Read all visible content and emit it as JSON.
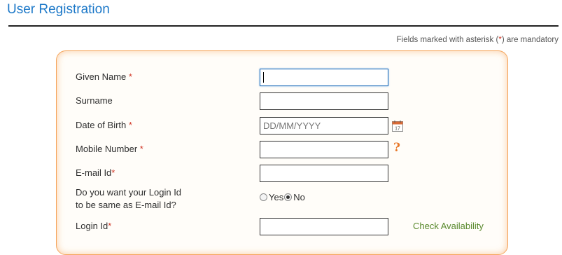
{
  "page": {
    "title": "User Registration",
    "mandatory_note": {
      "before": "Fields marked with asterisk (",
      "asterisk": "*",
      "after": ") are mandatory"
    }
  },
  "form": {
    "given_name": {
      "label": "Given Name",
      "required_mark": "*",
      "value": ""
    },
    "surname": {
      "label": "Surname",
      "value": ""
    },
    "date_of_birth": {
      "label": "Date of Birth",
      "required_mark": "*",
      "placeholder": "DD/MM/YYYY"
    },
    "mobile_number": {
      "label": "Mobile Number",
      "required_mark": "*",
      "value": ""
    },
    "email": {
      "label": "E-mail Id",
      "required_mark": "*",
      "value": ""
    },
    "login_same_question": {
      "line1": "Do you want your Login Id",
      "line2": "to be same as E-mail Id?",
      "options": [
        "Yes",
        "No"
      ],
      "selected": "No"
    },
    "login_id": {
      "label": "Login Id",
      "required_mark": "*",
      "value": ""
    },
    "check_availability": "Check Availability"
  },
  "icons": {
    "calendar": "calendar-icon",
    "help": "question-mark-icon",
    "help_glyph": "?"
  },
  "colors": {
    "title": "#1c78c8",
    "required": "#d23a2a",
    "panel_border": "#f5a45a",
    "help_icon": "#e8782a",
    "link": "#5a8a2e"
  }
}
